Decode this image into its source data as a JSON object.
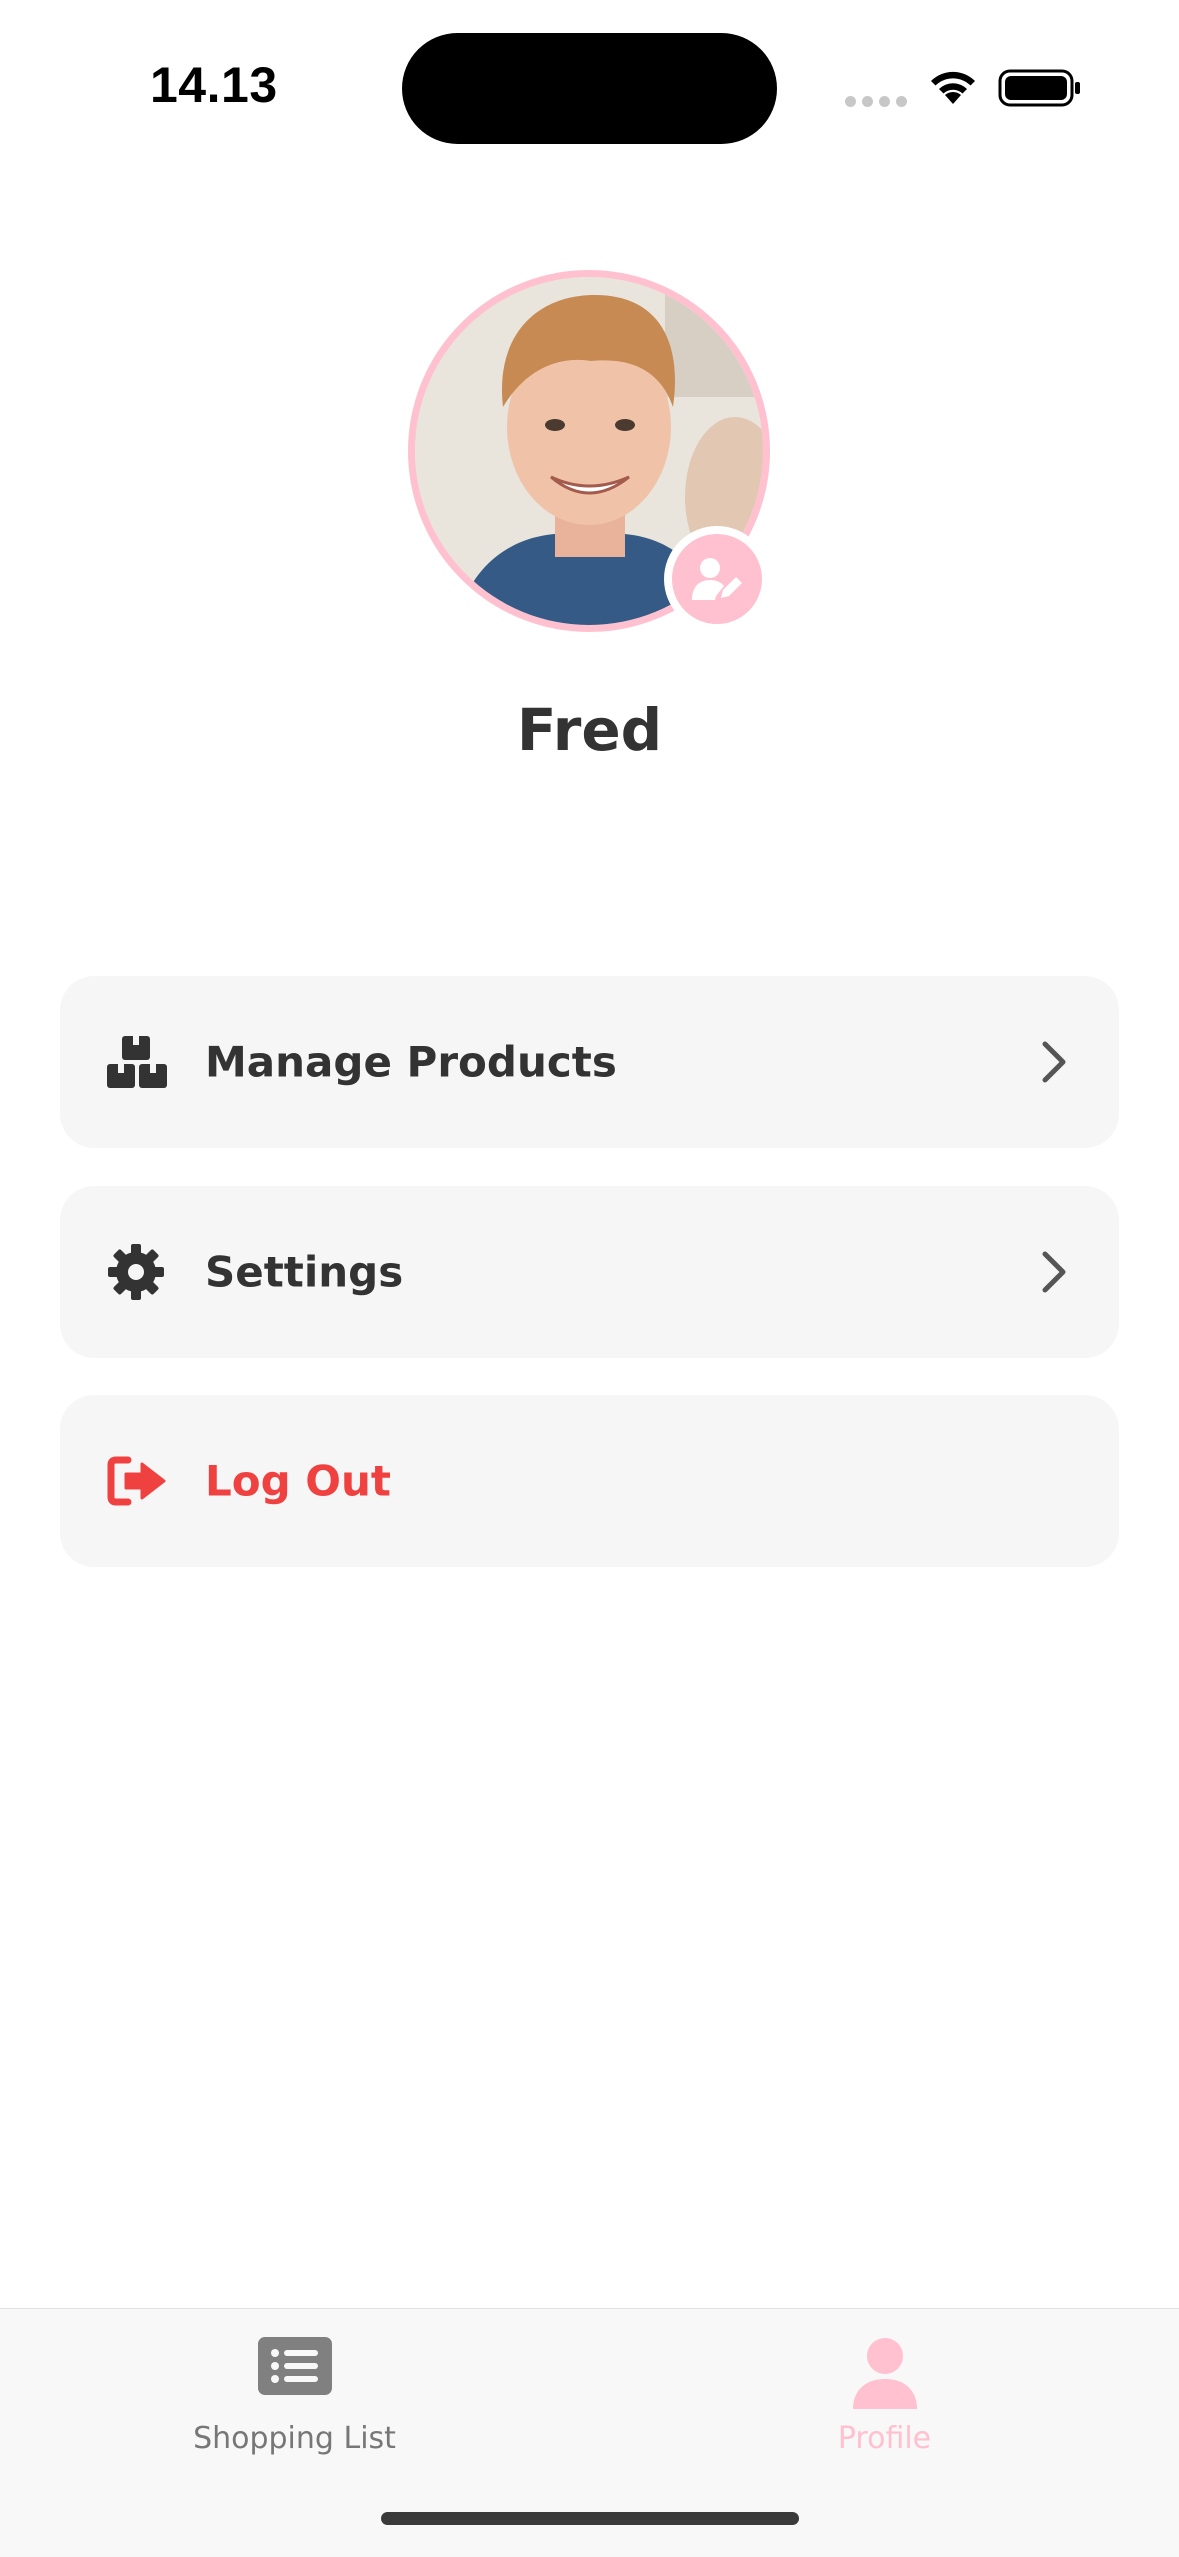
{
  "status_bar": {
    "time": "14.13"
  },
  "profile": {
    "name": "Fred",
    "avatar_icon": "user-photo",
    "edit_icon": "user-pen-icon",
    "accent_color": "#ffc0cf"
  },
  "menu": {
    "items": [
      {
        "label": "Manage Products",
        "icon": "boxes-icon",
        "has_chevron": true
      },
      {
        "label": "Settings",
        "icon": "gear-icon",
        "has_chevron": true
      },
      {
        "label": "Log Out",
        "icon": "logout-icon",
        "color": "#f04141",
        "has_chevron": false
      }
    ]
  },
  "tab_bar": {
    "tabs": [
      {
        "label": "Shopping List",
        "icon": "list-icon",
        "active": false
      },
      {
        "label": "Profile",
        "icon": "person-icon",
        "active": true
      }
    ]
  }
}
